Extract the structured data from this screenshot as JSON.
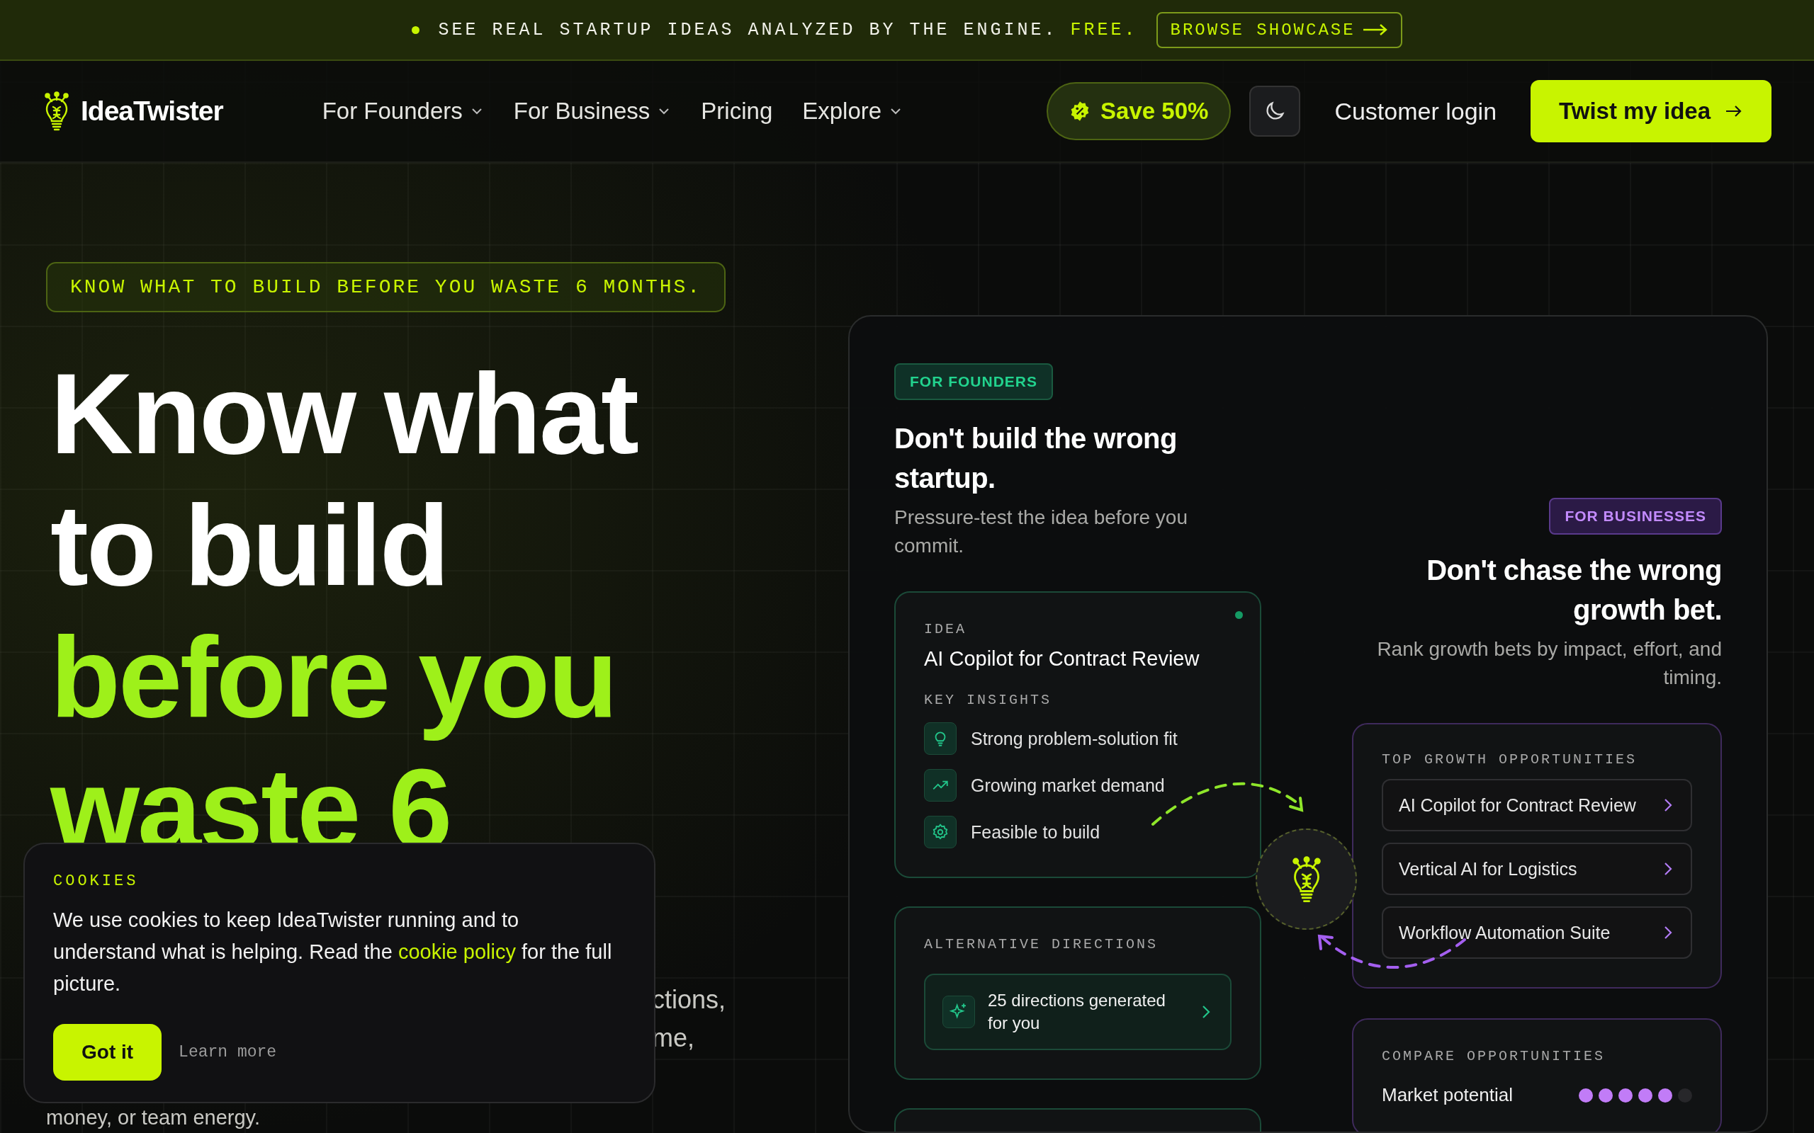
{
  "announcement": {
    "text": "SEE REAL STARTUP IDEAS ANALYZED BY THE ENGINE.",
    "highlight": "FREE.",
    "button": "BROWSE SHOWCASE"
  },
  "nav": {
    "brand": "IdeaTwister",
    "links": [
      {
        "label": "For Founders",
        "dropdown": true
      },
      {
        "label": "For Business",
        "dropdown": true
      },
      {
        "label": "Pricing",
        "dropdown": false
      },
      {
        "label": "Explore",
        "dropdown": true
      }
    ],
    "promo": "Save 50%",
    "login": "Customer login",
    "cta": "Twist my idea"
  },
  "hero": {
    "tagline": "KNOW WHAT TO BUILD BEFORE YOU WASTE 6 MONTHS.",
    "title_lines": [
      {
        "text": "Know what",
        "accent": false
      },
      {
        "text": "to build",
        "accent": false
      },
      {
        "text": "before you",
        "accent": true
      },
      {
        "text": "waste 6",
        "accent": true
      }
    ],
    "paragraph_lines": [
      "ctions,",
      "me,",
      "money, or team energy."
    ]
  },
  "founders": {
    "badge": "FOR FOUNDERS",
    "heading": "Don't build the wrong startup.",
    "subtitle": "Pressure-test the idea before you commit.",
    "idea_card": {
      "label": "IDEA",
      "title": "AI Copilot for Contract Review",
      "insights_label": "KEY INSIGHTS",
      "insights": [
        {
          "kind": "bulb",
          "text": "Strong problem-solution fit"
        },
        {
          "kind": "trend",
          "text": "Growing market demand"
        },
        {
          "kind": "gear",
          "text": "Feasible to build"
        }
      ]
    },
    "alternatives": {
      "label": "ALTERNATIVE DIRECTIONS",
      "item": "25 directions generated for you"
    }
  },
  "businesses": {
    "badge": "FOR BUSINESSES",
    "heading": "Don't chase the wrong growth bet.",
    "subtitle": "Rank growth bets by impact, effort, and timing.",
    "opportunities": {
      "label": "TOP GROWTH OPPORTUNITIES",
      "items": [
        "AI Copilot for Contract Review",
        "Vertical AI for Logistics",
        "Workflow Automation Suite"
      ]
    },
    "compare": {
      "label": "COMPARE OPPORTUNITIES",
      "rows": [
        {
          "name": "Market potential",
          "stars": 5
        }
      ]
    }
  },
  "cookie": {
    "label": "COOKIES",
    "text_before": "We use cookies to keep IdeaTwister running and to understand what is helping. Read the",
    "link": "cookie policy",
    "text_after": "for the full picture.",
    "accept": "Got it",
    "learn_more": "Learn more"
  }
}
